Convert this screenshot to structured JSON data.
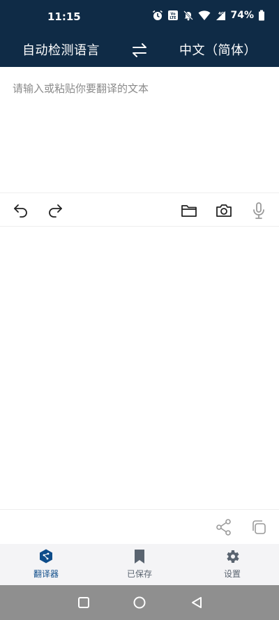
{
  "status_bar": {
    "time": "11:15",
    "battery_percent": "74%",
    "icons": [
      "alarm-icon",
      "volte-icon",
      "mute-icon",
      "wifi-icon",
      "signal-4g-icon",
      "battery-icon"
    ]
  },
  "language_bar": {
    "source_language": "自动检测语言",
    "target_language": "中文（简体）",
    "swap_icon": "swap-arrows-icon"
  },
  "input": {
    "placeholder": "请输入或粘贴你要翻译的文本",
    "value": ""
  },
  "tools": {
    "left": [
      "undo-icon",
      "redo-icon"
    ],
    "right": [
      "folder-icon",
      "camera-icon",
      "microphone-icon"
    ]
  },
  "output_actions": [
    "share-icon",
    "copy-icon"
  ],
  "bottom_nav": {
    "items": [
      {
        "label": "翻译器",
        "icon": "translator-icon",
        "active": true
      },
      {
        "label": "已保存",
        "icon": "bookmark-icon",
        "active": false
      },
      {
        "label": "设置",
        "icon": "gear-icon",
        "active": false
      }
    ]
  },
  "colors": {
    "header_bg": "#0f2b46",
    "accent": "#0f4d8a",
    "nav_bg": "#f4f4f6",
    "system_nav_bg": "#8f8f8f"
  }
}
